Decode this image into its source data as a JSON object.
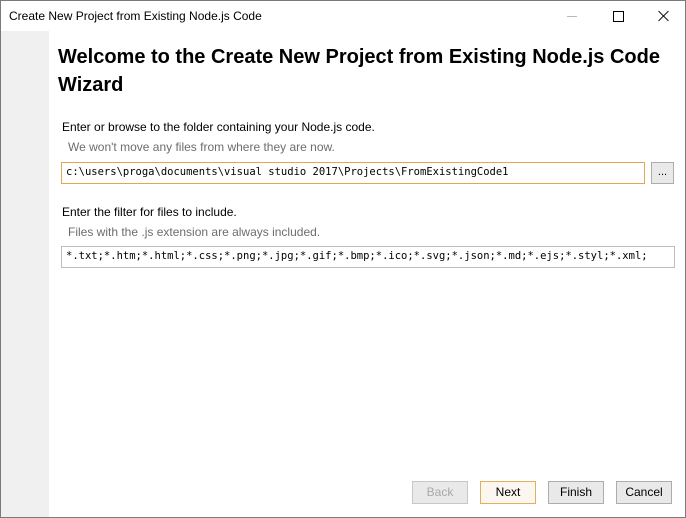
{
  "window": {
    "title": "Create New Project from Existing Node.js Code"
  },
  "wizard": {
    "heading": "Welcome to the Create New Project from Existing Node.js Code Wizard",
    "folder_label": "Enter or browse to the folder containing your Node.js code.",
    "folder_hint": "We won't move any files from where they are now.",
    "folder_value": "c:\\users\\proga\\documents\\visual studio 2017\\Projects\\FromExistingCode1",
    "browse_label": "...",
    "filter_label": "Enter the filter for files to include.",
    "filter_hint": "Files with the .js extension are always included.",
    "filter_value": "*.txt;*.htm;*.html;*.css;*.png;*.jpg;*.gif;*.bmp;*.ico;*.svg;*.json;*.md;*.ejs;*.styl;*.xml;"
  },
  "buttons": {
    "back": "Back",
    "next": "Next",
    "finish": "Finish",
    "cancel": "Cancel"
  }
}
